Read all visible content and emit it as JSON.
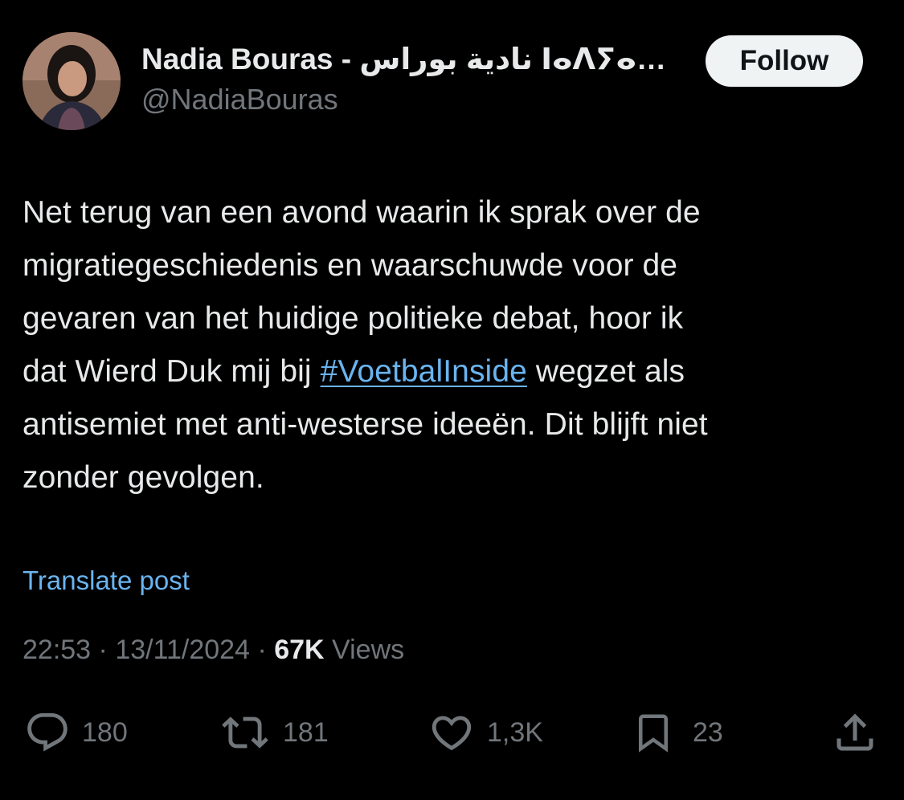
{
  "author": {
    "display_name": "Nadia Bouras - نادية بوراس ⵏⴰⴷⵢⴰ…",
    "handle": "@NadiaBouras",
    "follow_label": "Follow"
  },
  "post": {
    "lines": [
      "Net terug van een avond waarin ik sprak over de",
      "migratiegeschiedenis en waarschuwde voor de",
      "gevaren van het huidige politieke debat, hoor ik"
    ],
    "line4_before": "dat Wierd Duk mij bij ",
    "hashtag": "#VoetbalInside",
    "line4_after": " wegzet als",
    "lines_end": [
      "antisemiet met anti-westerse ideeën. Dit blijft niet",
      "zonder gevolgen."
    ],
    "translate_label": "Translate post"
  },
  "meta": {
    "time": "22:53",
    "separator": "·",
    "date": "13/11/2024",
    "views_count": "67K",
    "views_label": "Views"
  },
  "actions": {
    "replies": "180",
    "reposts": "181",
    "likes": "1,3K",
    "bookmarks": "23"
  },
  "colors": {
    "background": "#000000",
    "text": "#e7e9ea",
    "secondary": "#71767b",
    "link": "#6ab4f0",
    "follow_bg": "#eff3f4"
  }
}
